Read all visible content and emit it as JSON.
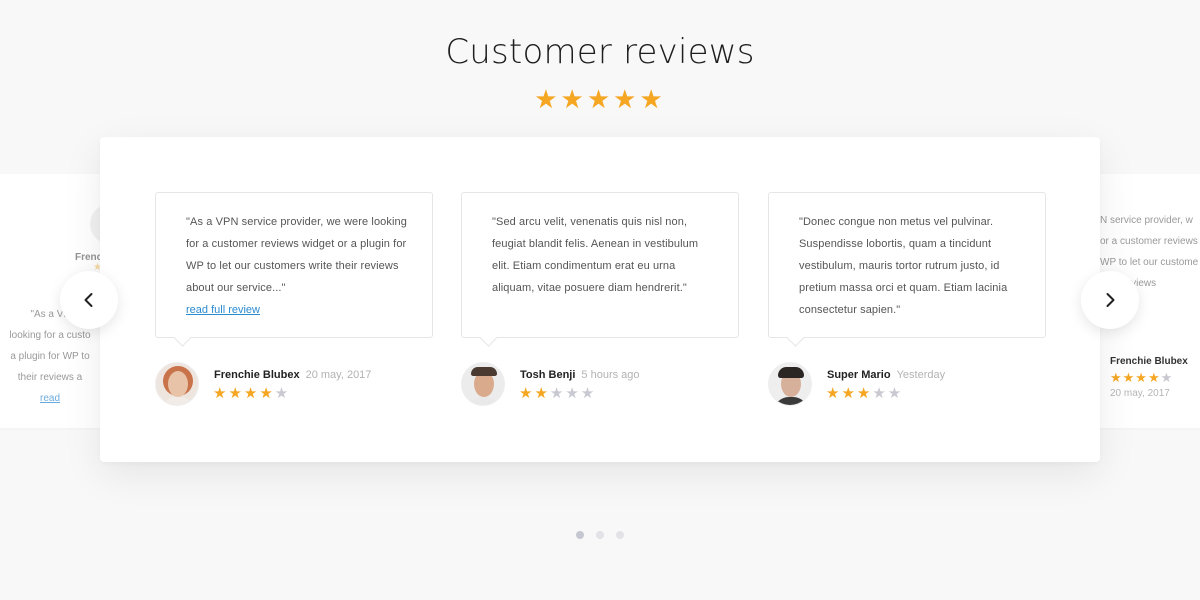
{
  "header": {
    "title": "Customer reviews",
    "stars": "★★★★★",
    "rating": 5
  },
  "colors": {
    "star": "#f5a623",
    "star_empty": "#c9c9d1",
    "link": "#2a8bd1",
    "background": "#f8f8f9"
  },
  "side_left": {
    "name": "Frenc",
    "text_lines": [
      "\"As a VF",
      "looking for a custo",
      "a plugin for WP to",
      "their reviews a",
      "read"
    ]
  },
  "side_right": {
    "text_lines": [
      "N service provider, w",
      "or a customer reviews",
      "WP to let our custome",
      "their reviews"
    ],
    "name": "Frenchie Blubex",
    "rating": 4,
    "date": "20 may, 2017"
  },
  "reviews": [
    {
      "text": "\"As a VPN service provider, we were looking for a customer reviews widget or a plugin for WP to let our customers write their reviews about our service...\"",
      "link": "read full review",
      "author": "Frenchie Blubex",
      "date": "20 may, 2017",
      "rating": 4,
      "avatar": "woman-avatar"
    },
    {
      "text": "\"Sed arcu velit, venenatis quis nisl non, feugiat blandit felis. Aenean in vestibulum elit. Etiam condimentum erat eu urna aliquam, vitae posuere diam hendrerit.\"",
      "link": "",
      "author": "Tosh Benji",
      "date": "5 hours ago",
      "rating": 2,
      "avatar": "man-avatar"
    },
    {
      "text": "\"Donec congue non metus vel pulvinar. Suspendisse lobortis, quam a tincidunt vestibulum, mauris tortor rutrum justo, id pretium massa orci et quam. Etiam lacinia consectetur sapien.\"",
      "link": "",
      "author": "Super Mario",
      "date": "Yesterday",
      "rating": 3,
      "avatar": "man-avatar"
    }
  ],
  "pagination": {
    "count": 3,
    "active": 0
  }
}
